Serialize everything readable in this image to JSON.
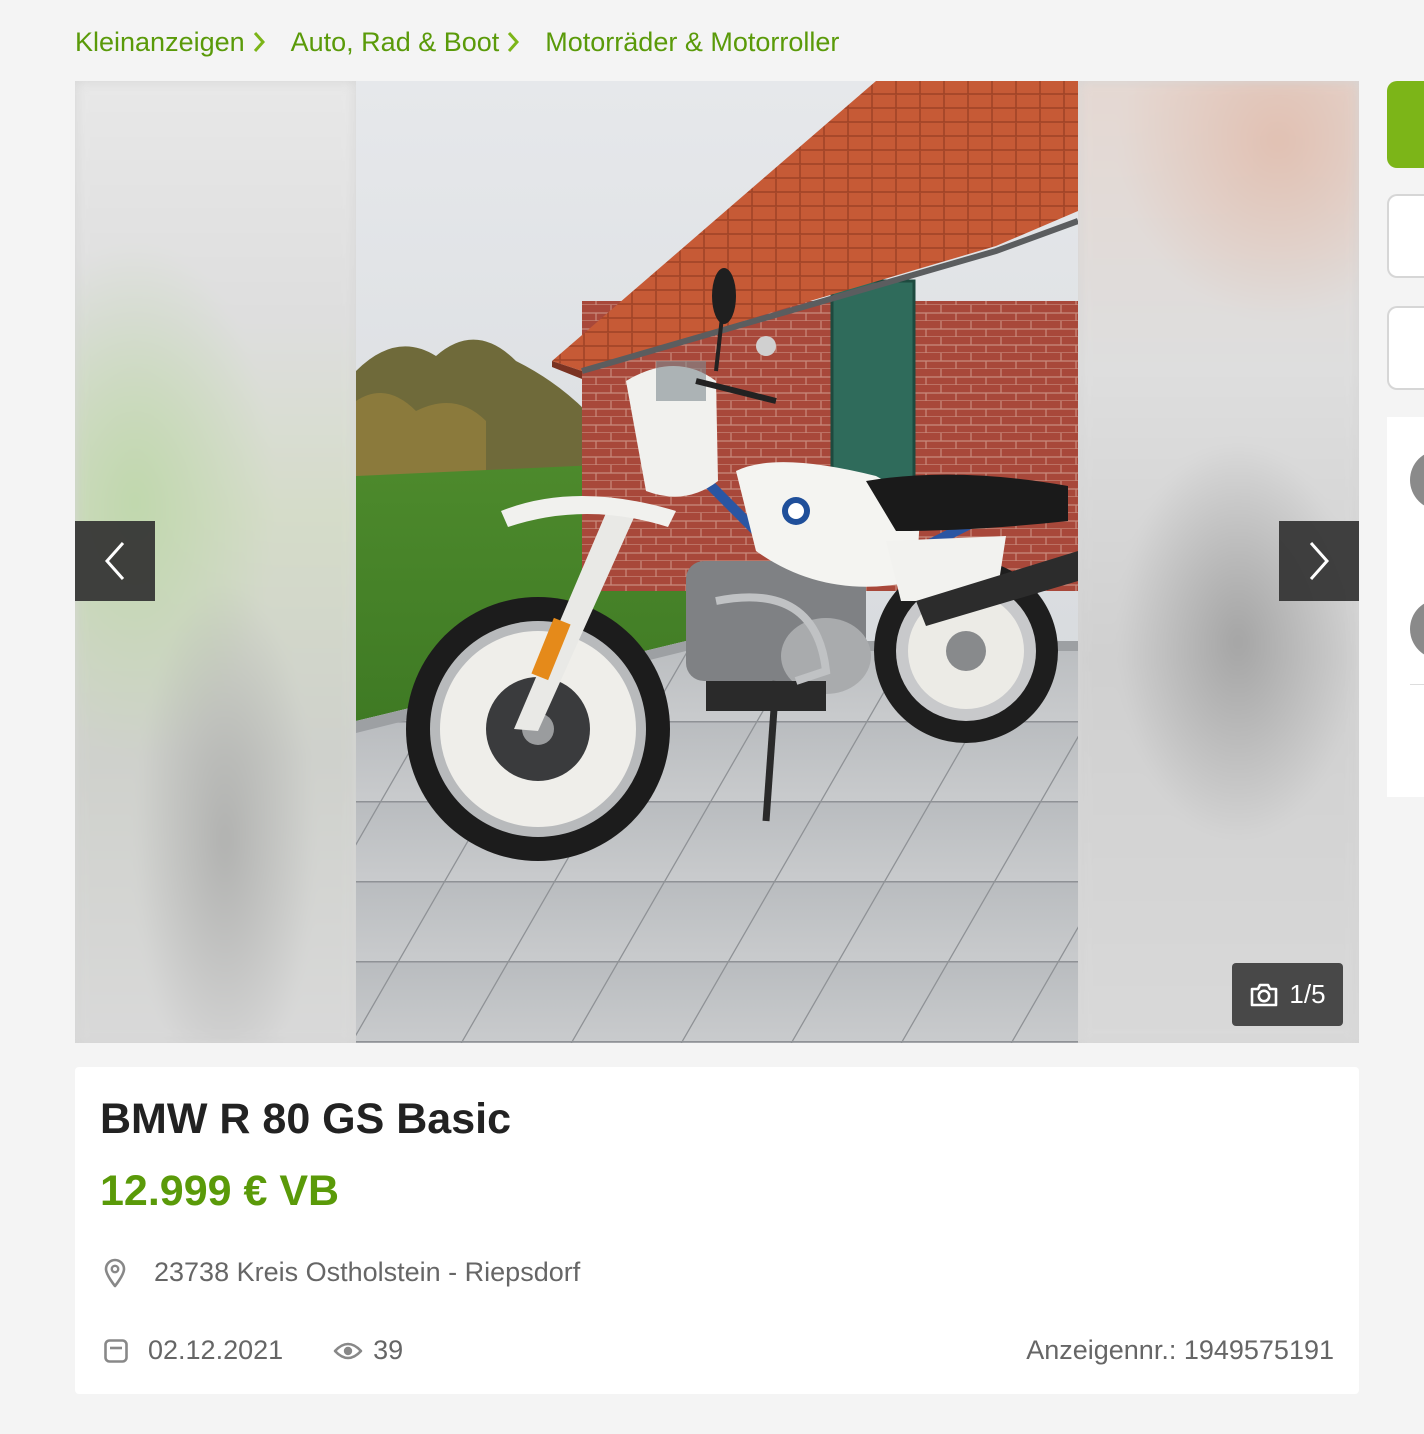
{
  "breadcrumb": {
    "items": [
      {
        "label": "Kleinanzeigen"
      },
      {
        "label": "Auto, Rad & Boot"
      },
      {
        "label": "Motorräder & Motorroller"
      }
    ]
  },
  "gallery": {
    "counter": "1/5",
    "current_image": 1,
    "total_images": 5
  },
  "listing": {
    "title": "BMW R 80 GS Basic",
    "price": "12.999 € VB",
    "location": "23738 Kreis Ostholstein - Riepsdorf",
    "date": "02.12.2021",
    "views": "39",
    "ad_number": "Anzeigennr.: 1949575191"
  },
  "colors": {
    "accent_green": "#5a9a09",
    "button_green": "#7cb518",
    "text_dark": "#222222",
    "text_muted": "#666666",
    "page_background": "#f4f4f4"
  },
  "icons": {
    "breadcrumb_separator": "chevron-right-icon",
    "gallery_prev": "chevron-left-icon",
    "gallery_next": "chevron-right-icon",
    "counter": "camera-icon",
    "location": "map-pin-icon",
    "date": "calendar-icon",
    "views": "eye-icon"
  }
}
